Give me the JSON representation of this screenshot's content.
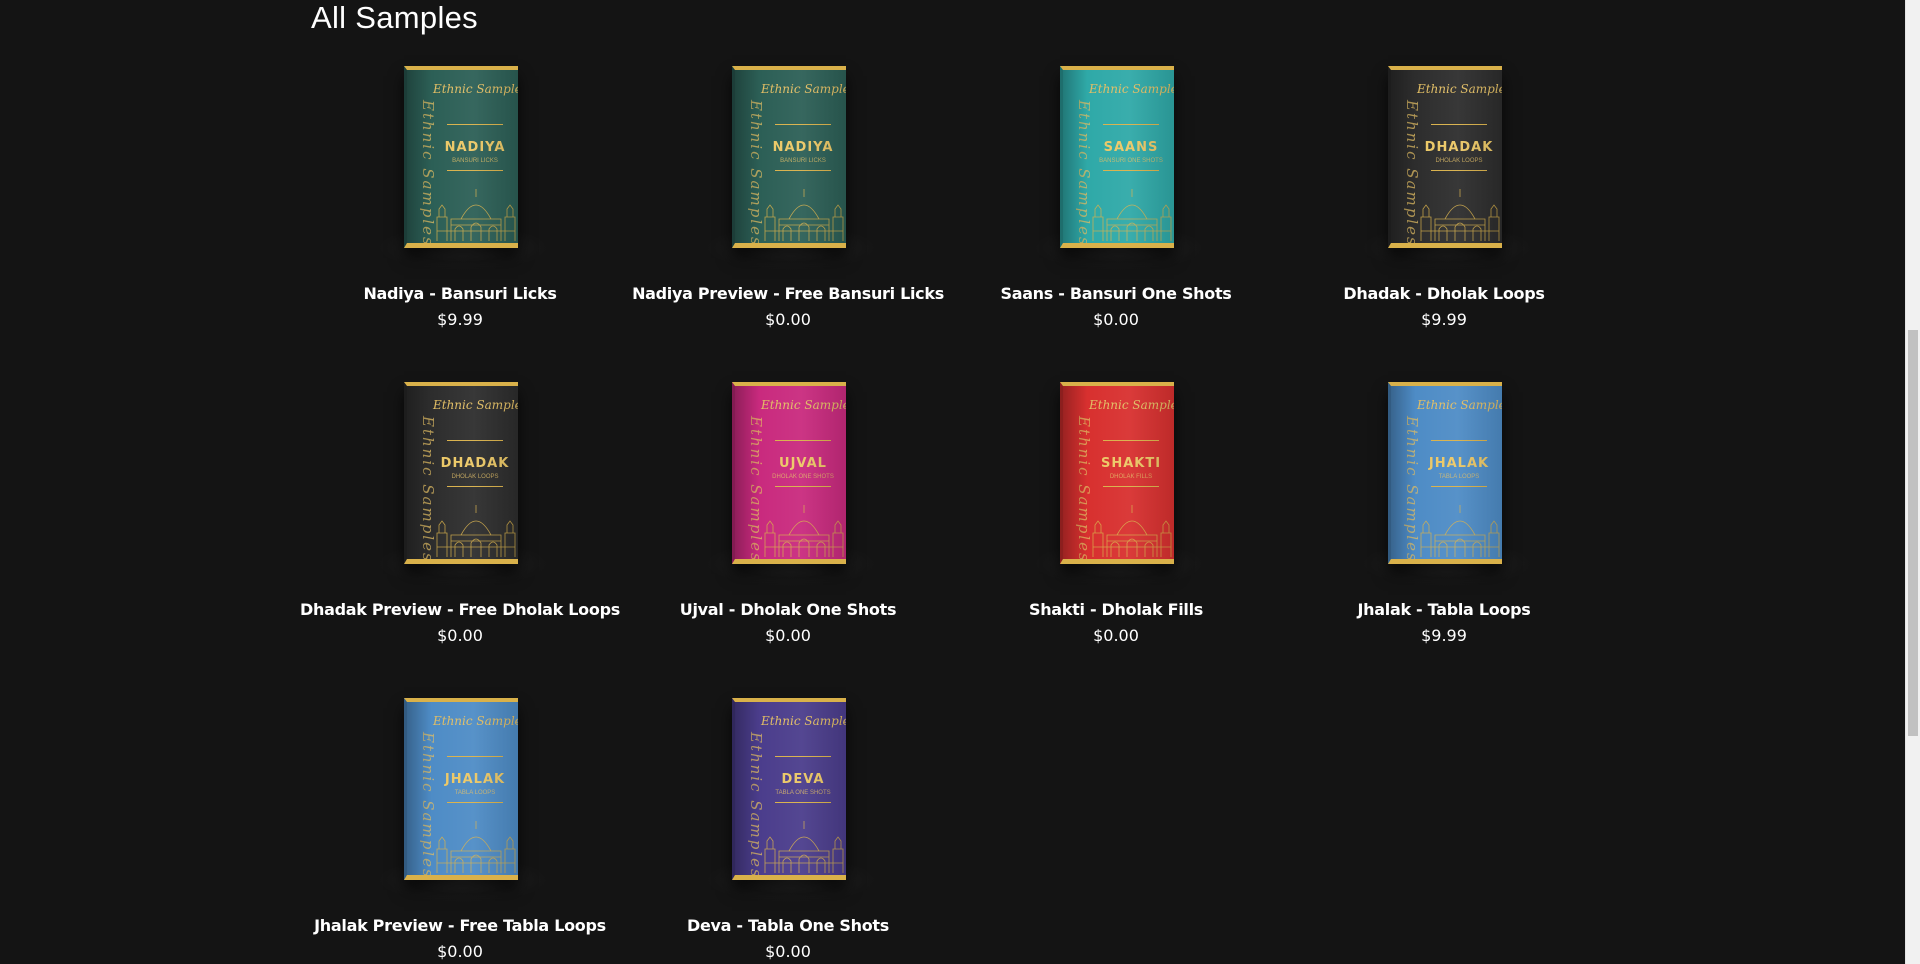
{
  "section": {
    "title": "All Samples"
  },
  "box_brand": "Ethnic Samples",
  "products": [
    {
      "title": "Nadiya - Bansuri Licks",
      "price": "$9.99",
      "box_name": "NADIYA",
      "box_subtitle": "BANSURI LICKS",
      "box_color": "#2c5f56",
      "icon": "nadiya-box-art"
    },
    {
      "title": "Nadiya Preview - Free Bansuri Licks",
      "price": "$0.00",
      "box_name": "NADIYA",
      "box_subtitle": "BANSURI LICKS",
      "box_color": "#2c5f56",
      "icon": "nadiya-box-art"
    },
    {
      "title": "Saans - Bansuri One Shots",
      "price": "$0.00",
      "box_name": "SAANS",
      "box_subtitle": "BANSURI ONE SHOTS",
      "box_color": "#2fa9a8",
      "icon": "saans-box-art"
    },
    {
      "title": "Dhadak - Dholak Loops",
      "price": "$9.99",
      "box_name": "DHADAK",
      "box_subtitle": "DHOLAK LOOPS",
      "box_color": "#2d2d2d",
      "icon": "dhadak-box-art"
    },
    {
      "title": "Dhadak Preview - Free Dholak Loops",
      "price": "$0.00",
      "box_name": "DHADAK",
      "box_subtitle": "DHOLAK LOOPS",
      "box_color": "#2d2d2d",
      "icon": "dhadak-box-art"
    },
    {
      "title": "Ujval - Dholak One Shots",
      "price": "$0.00",
      "box_name": "UJVAL",
      "box_subtitle": "DHOLAK ONE SHOTS",
      "box_color": "#c92a7e",
      "icon": "ujval-box-art"
    },
    {
      "title": "Shakti - Dholak Fills",
      "price": "$0.00",
      "box_name": "SHAKTI",
      "box_subtitle": "DHOLAK FILLS",
      "box_color": "#d8302f",
      "icon": "shakti-box-art"
    },
    {
      "title": "Jhalak - Tabla Loops",
      "price": "$9.99",
      "box_name": "JHALAK",
      "box_subtitle": "TABLA LOOPS",
      "box_color": "#4e8cc6",
      "icon": "jhalak-box-art"
    },
    {
      "title": "Jhalak Preview - Free Tabla Loops",
      "price": "$0.00",
      "box_name": "JHALAK",
      "box_subtitle": "TABLA LOOPS",
      "box_color": "#4e8cc6",
      "icon": "jhalak-box-art"
    },
    {
      "title": "Deva - Tabla One Shots",
      "price": "$0.00",
      "box_name": "DEVA",
      "box_subtitle": "TABLA ONE SHOTS",
      "box_color": "#4b3d8c",
      "icon": "deva-box-art"
    }
  ],
  "colors": {
    "background": "#141414",
    "gold": "#d9b14a",
    "text": "#ffffff"
  }
}
